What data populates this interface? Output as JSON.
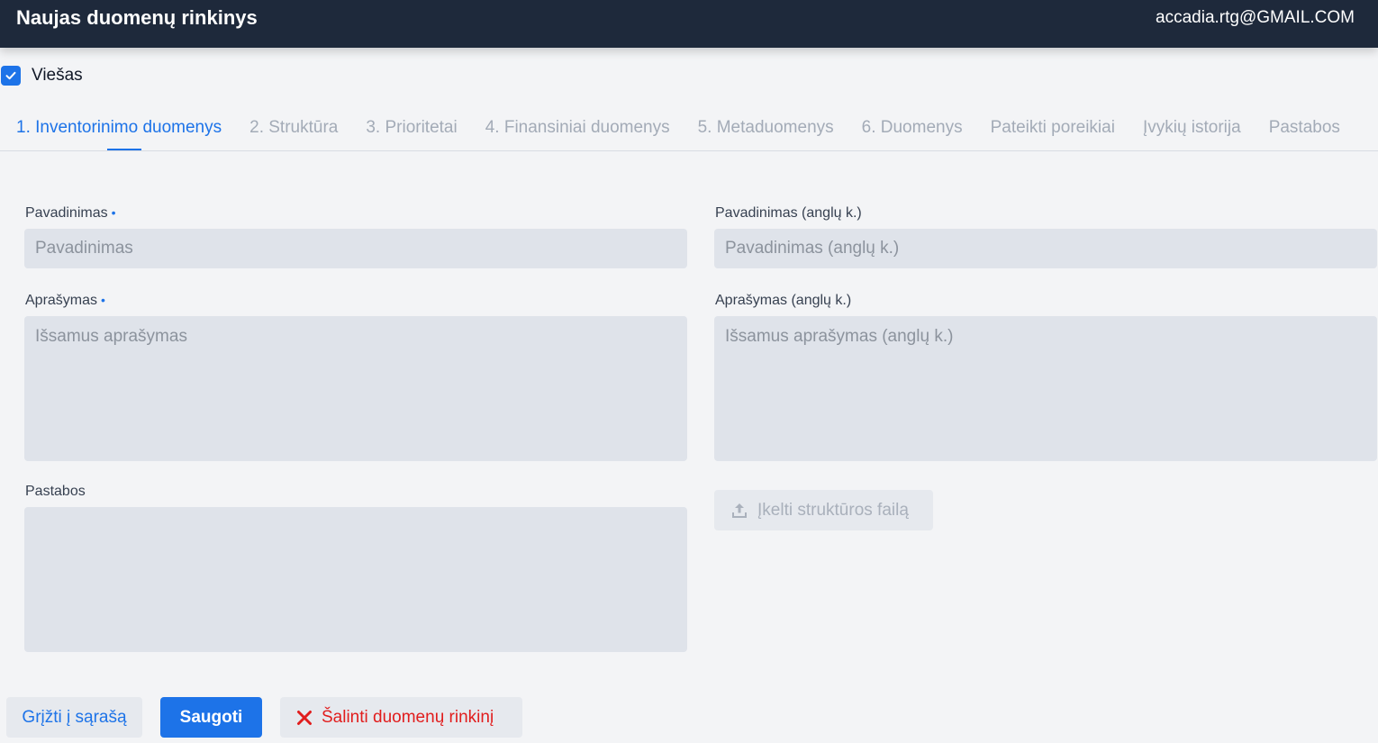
{
  "header": {
    "title": "Naujas duomenų rinkinys",
    "user_email": "accadia.rtg@GMAIL.COM"
  },
  "public_checkbox": {
    "label": "Viešas",
    "checked": true
  },
  "tabs": [
    {
      "label": "1. Inventorinimo duomenys",
      "active": true
    },
    {
      "label": "2. Struktūra"
    },
    {
      "label": "3. Prioritetai"
    },
    {
      "label": "4. Finansiniai duomenys"
    },
    {
      "label": "5. Metaduomenys"
    },
    {
      "label": "6. Duomenys"
    },
    {
      "label": "Pateikti poreikiai"
    },
    {
      "label": "Įvykių istorija"
    },
    {
      "label": "Pastabos"
    }
  ],
  "form": {
    "name": {
      "label": "Pavadinimas",
      "required_mark": "•",
      "placeholder": "Pavadinimas",
      "value": ""
    },
    "name_en": {
      "label": "Pavadinimas (anglų k.)",
      "placeholder": "Pavadinimas (anglų k.)",
      "value": ""
    },
    "description": {
      "label": "Aprašymas",
      "required_mark": "•",
      "placeholder": "Išsamus aprašymas",
      "value": ""
    },
    "description_en": {
      "label": "Aprašymas (anglų k.)",
      "placeholder": "Išsamus aprašymas (anglų k.)",
      "value": ""
    },
    "notes": {
      "label": "Pastabos",
      "placeholder": "",
      "value": ""
    },
    "upload_button": {
      "label": "Įkelti struktūros failą",
      "icon": "upload-icon",
      "enabled": false
    }
  },
  "actions": {
    "back_label": "Grįžti į sąrašą",
    "save_label": "Saugoti",
    "delete_label": "Šalinti duomenų rinkinį",
    "delete_icon": "close-icon"
  },
  "colors": {
    "header_bg": "#1e293b",
    "accent": "#1d73e8",
    "danger": "#e11d1d",
    "input_bg": "#dfe3ea",
    "page_bg": "#f3f4f6"
  }
}
